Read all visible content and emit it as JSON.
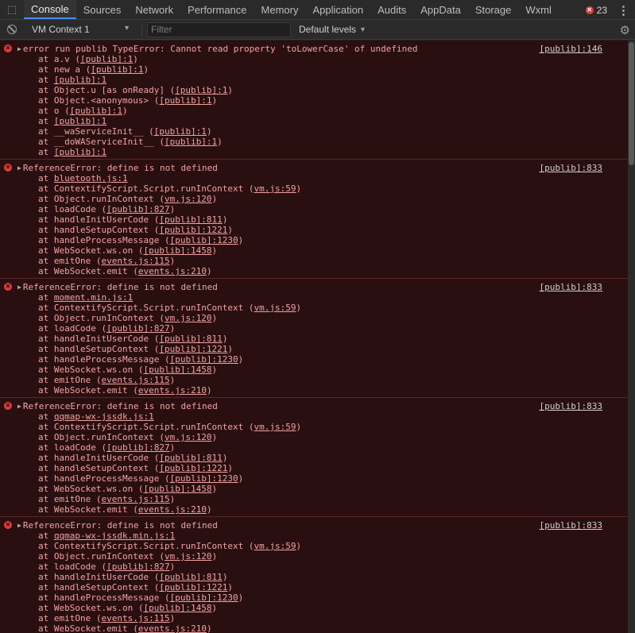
{
  "tabs": [
    "Console",
    "Sources",
    "Network",
    "Performance",
    "Memory",
    "Application",
    "Audits",
    "AppData",
    "Storage",
    "Wxml"
  ],
  "error_count": "23",
  "toolbar": {
    "context": "VM Context 1",
    "filter_placeholder": "Filter",
    "levels": "Default levels"
  },
  "messages": [
    {
      "head": "error run publib TypeError: Cannot read property 'toLowerCase' of undefined",
      "source": "[publib]:146",
      "frames": [
        {
          "pre": "at a.v (",
          "link": "[publib]:1",
          "post": ")"
        },
        {
          "pre": "at new a (",
          "link": "[publib]:1",
          "post": ")"
        },
        {
          "pre": "at ",
          "link": "[publib]:1",
          "post": ""
        },
        {
          "pre": "at Object.u [as onReady] (",
          "link": "[publib]:1",
          "post": ")"
        },
        {
          "pre": "at Object.<anonymous> (",
          "link": "[publib]:1",
          "post": ")"
        },
        {
          "pre": "at o (",
          "link": "[publib]:1",
          "post": ")"
        },
        {
          "pre": "at ",
          "link": "[publib]:1",
          "post": ""
        },
        {
          "pre": "at __waServiceInit__ (",
          "link": "[publib]:1",
          "post": ")"
        },
        {
          "pre": "at __doWAServiceInit__ (",
          "link": "[publib]:1",
          "post": ")"
        },
        {
          "pre": "at ",
          "link": "[publib]:1",
          "post": ""
        }
      ]
    },
    {
      "head": "ReferenceError: define is not defined",
      "source": "[publib]:833",
      "frames": [
        {
          "pre": "at ",
          "link": "bluetooth.js:1",
          "post": ""
        },
        {
          "pre": "at ContextifyScript.Script.runInContext (",
          "link": "vm.js:59",
          "post": ")"
        },
        {
          "pre": "at Object.runInContext (",
          "link": "vm.js:120",
          "post": ")"
        },
        {
          "pre": "at loadCode (",
          "link": "[publib]:827",
          "post": ")"
        },
        {
          "pre": "at handleInitUserCode (",
          "link": "[publib]:811",
          "post": ")"
        },
        {
          "pre": "at handleSetupContext (",
          "link": "[publib]:1221",
          "post": ")"
        },
        {
          "pre": "at handleProcessMessage (",
          "link": "[publib]:1230",
          "post": ")"
        },
        {
          "pre": "at WebSocket.ws.on (",
          "link": "[publib]:1458",
          "post": ")"
        },
        {
          "pre": "at emitOne (",
          "link": "events.js:115",
          "post": ")"
        },
        {
          "pre": "at WebSocket.emit (",
          "link": "events.js:210",
          "post": ")"
        }
      ]
    },
    {
      "head": "ReferenceError: define is not defined",
      "source": "[publib]:833",
      "frames": [
        {
          "pre": "at ",
          "link": "moment.min.js:1",
          "post": ""
        },
        {
          "pre": "at ContextifyScript.Script.runInContext (",
          "link": "vm.js:59",
          "post": ")"
        },
        {
          "pre": "at Object.runInContext (",
          "link": "vm.js:120",
          "post": ")"
        },
        {
          "pre": "at loadCode (",
          "link": "[publib]:827",
          "post": ")"
        },
        {
          "pre": "at handleInitUserCode (",
          "link": "[publib]:811",
          "post": ")"
        },
        {
          "pre": "at handleSetupContext (",
          "link": "[publib]:1221",
          "post": ")"
        },
        {
          "pre": "at handleProcessMessage (",
          "link": "[publib]:1230",
          "post": ")"
        },
        {
          "pre": "at WebSocket.ws.on (",
          "link": "[publib]:1458",
          "post": ")"
        },
        {
          "pre": "at emitOne (",
          "link": "events.js:115",
          "post": ")"
        },
        {
          "pre": "at WebSocket.emit (",
          "link": "events.js:210",
          "post": ")"
        }
      ]
    },
    {
      "head": "ReferenceError: define is not defined",
      "source": "[publib]:833",
      "frames": [
        {
          "pre": "at ",
          "link": "qqmap-wx-jssdk.js:1",
          "post": ""
        },
        {
          "pre": "at ContextifyScript.Script.runInContext (",
          "link": "vm.js:59",
          "post": ")"
        },
        {
          "pre": "at Object.runInContext (",
          "link": "vm.js:120",
          "post": ")"
        },
        {
          "pre": "at loadCode (",
          "link": "[publib]:827",
          "post": ")"
        },
        {
          "pre": "at handleInitUserCode (",
          "link": "[publib]:811",
          "post": ")"
        },
        {
          "pre": "at handleSetupContext (",
          "link": "[publib]:1221",
          "post": ")"
        },
        {
          "pre": "at handleProcessMessage (",
          "link": "[publib]:1230",
          "post": ")"
        },
        {
          "pre": "at WebSocket.ws.on (",
          "link": "[publib]:1458",
          "post": ")"
        },
        {
          "pre": "at emitOne (",
          "link": "events.js:115",
          "post": ")"
        },
        {
          "pre": "at WebSocket.emit (",
          "link": "events.js:210",
          "post": ")"
        }
      ]
    },
    {
      "head": "ReferenceError: define is not defined",
      "source": "[publib]:833",
      "frames": [
        {
          "pre": "at ",
          "link": "qqmap-wx-jssdk.min.js:1",
          "post": ""
        },
        {
          "pre": "at ContextifyScript.Script.runInContext (",
          "link": "vm.js:59",
          "post": ")"
        },
        {
          "pre": "at Object.runInContext (",
          "link": "vm.js:120",
          "post": ")"
        },
        {
          "pre": "at loadCode (",
          "link": "[publib]:827",
          "post": ")"
        },
        {
          "pre": "at handleInitUserCode (",
          "link": "[publib]:811",
          "post": ")"
        },
        {
          "pre": "at handleSetupContext (",
          "link": "[publib]:1221",
          "post": ")"
        },
        {
          "pre": "at handleProcessMessage (",
          "link": "[publib]:1230",
          "post": ")"
        },
        {
          "pre": "at WebSocket.ws.on (",
          "link": "[publib]:1458",
          "post": ")"
        },
        {
          "pre": "at emitOne (",
          "link": "events.js:115",
          "post": ")"
        },
        {
          "pre": "at WebSocket.emit (",
          "link": "events.js:210",
          "post": ")"
        }
      ]
    }
  ]
}
